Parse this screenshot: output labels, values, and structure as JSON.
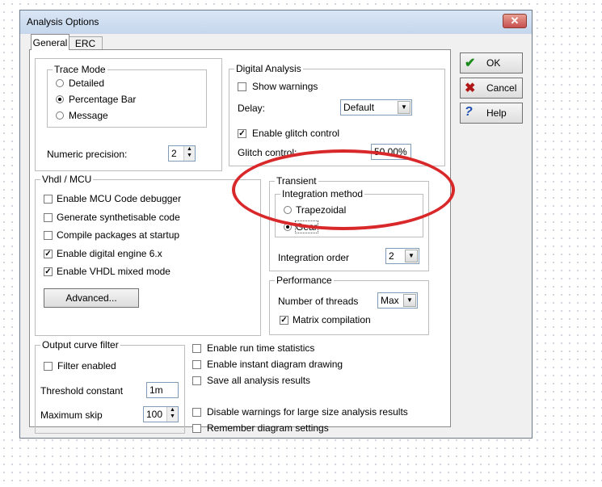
{
  "window": {
    "title": "Analysis Options",
    "close": "✕"
  },
  "tabs": [
    {
      "label": "General"
    },
    {
      "label": "ERC"
    }
  ],
  "trace_mode": {
    "title": "Trace Mode",
    "options": [
      "Detailed",
      "Percentage Bar",
      "Message"
    ],
    "selected": "Percentage Bar"
  },
  "numeric_precision": {
    "label": "Numeric precision:",
    "value": "2"
  },
  "digital_analysis": {
    "title": "Digital Analysis",
    "show_warnings": {
      "label": "Show warnings",
      "checked": false
    },
    "delay": {
      "label": "Delay:",
      "value": "Default"
    },
    "enable_glitch": {
      "label": "Enable glitch control",
      "checked": true
    },
    "glitch_control": {
      "label": "Glitch control:",
      "value": "50.00%"
    }
  },
  "vhdl_mcu": {
    "title": "Vhdl / MCU",
    "items": [
      {
        "label": "Enable MCU Code debugger",
        "checked": false
      },
      {
        "label": "Generate synthetisable code",
        "checked": false
      },
      {
        "label": "Compile packages at startup",
        "checked": false
      },
      {
        "label": "Enable digital engine 6.x",
        "checked": true
      },
      {
        "label": "Enable VHDL mixed mode",
        "checked": true
      }
    ],
    "advanced_label": "Advanced..."
  },
  "transient": {
    "title": "Transient",
    "integration_method": {
      "title": "Integration method",
      "options": [
        "Trapezoidal",
        "Gear"
      ],
      "selected": "Gear"
    },
    "integration_order": {
      "label": "Integration order",
      "value": "2"
    }
  },
  "performance": {
    "title": "Performance",
    "threads": {
      "label": "Number of threads",
      "value": "Max"
    },
    "matrix": {
      "label": "Matrix compilation",
      "checked": true
    }
  },
  "output_curve_filter": {
    "title": "Output curve filter",
    "filter_enabled": {
      "label": "Filter enabled",
      "checked": false
    },
    "threshold": {
      "label": "Threshold constant",
      "value": "1m"
    },
    "max_skip": {
      "label": "Maximum skip",
      "value": "100"
    }
  },
  "misc_options": [
    {
      "label": "Enable run time statistics",
      "checked": false
    },
    {
      "label": "Enable instant diagram drawing",
      "checked": false
    },
    {
      "label": "Save all analysis results",
      "checked": false
    },
    {
      "label": "Disable warnings for large size analysis results",
      "checked": false
    },
    {
      "label": "Remember diagram settings",
      "checked": false
    }
  ],
  "buttons": {
    "ok": {
      "label": "OK",
      "icon": "check-icon",
      "glyph": "✔",
      "color": "#1a8a1a"
    },
    "cancel": {
      "label": "Cancel",
      "icon": "x-icon",
      "glyph": "✖",
      "color": "#b01818"
    },
    "help": {
      "label": "Help",
      "icon": "question-icon",
      "glyph": "?",
      "color": "#1f4fb0"
    }
  },
  "annotation": {
    "color": "#d9282a"
  }
}
